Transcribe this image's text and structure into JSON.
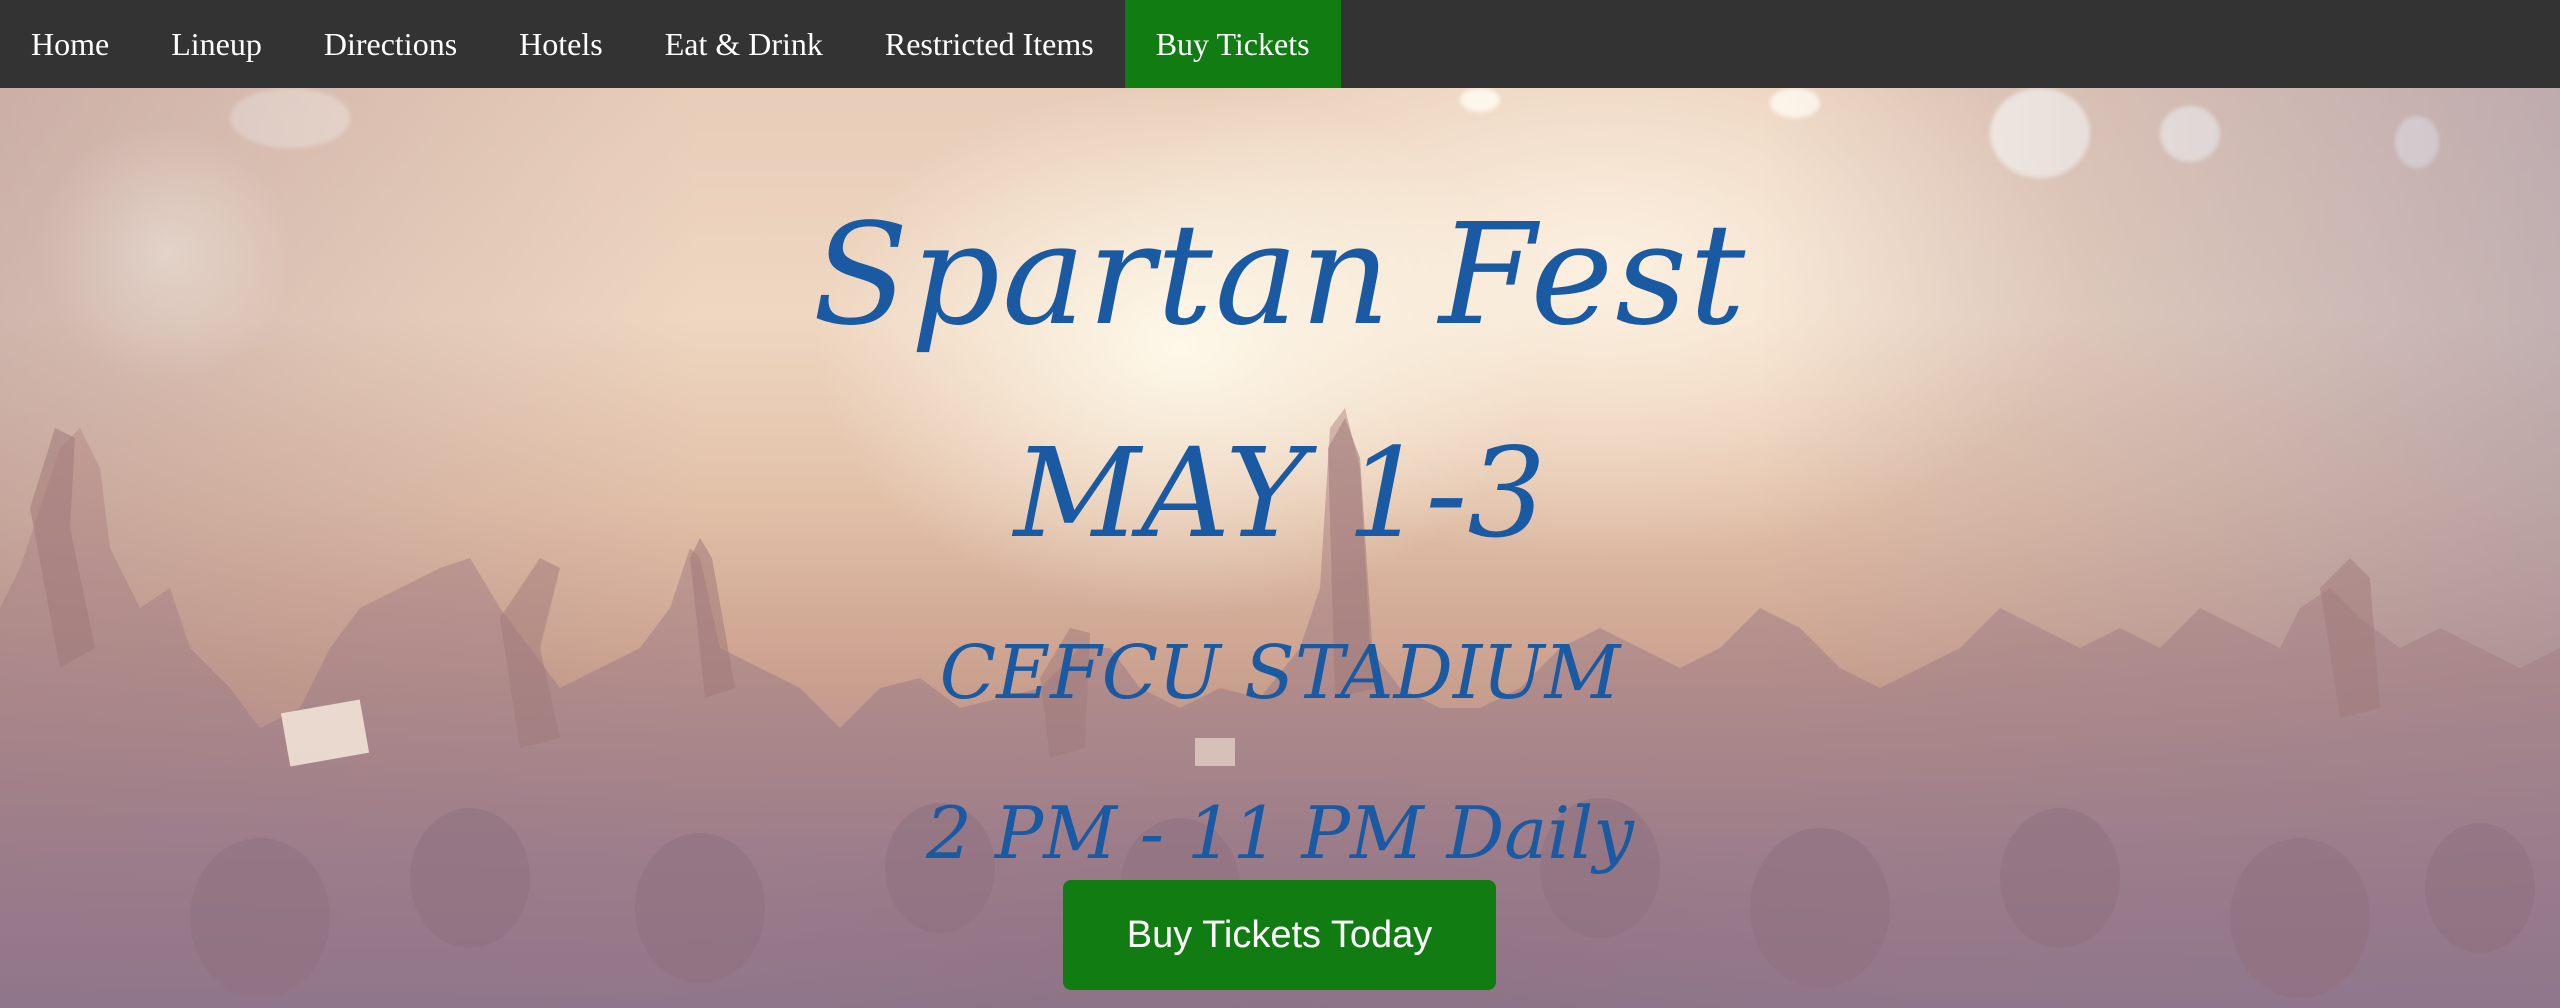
{
  "nav": {
    "items": [
      {
        "label": "Home",
        "active": false
      },
      {
        "label": "Lineup",
        "active": false
      },
      {
        "label": "Directions",
        "active": false
      },
      {
        "label": "Hotels",
        "active": false
      },
      {
        "label": "Eat & Drink",
        "active": false
      },
      {
        "label": "Restricted Items",
        "active": false
      },
      {
        "label": "Buy Tickets",
        "active": true
      }
    ],
    "background_color": "#333333",
    "active_color": "#117c11"
  },
  "hero": {
    "title": "Spartan Fest",
    "dates": "MAY 1-3",
    "venue": "CEFCU STADIUM",
    "hours": "2 PM - 11 PM Daily",
    "text_color": "#1a5aa2",
    "cta_label": "Buy Tickets Today",
    "cta_color": "#117c11"
  }
}
